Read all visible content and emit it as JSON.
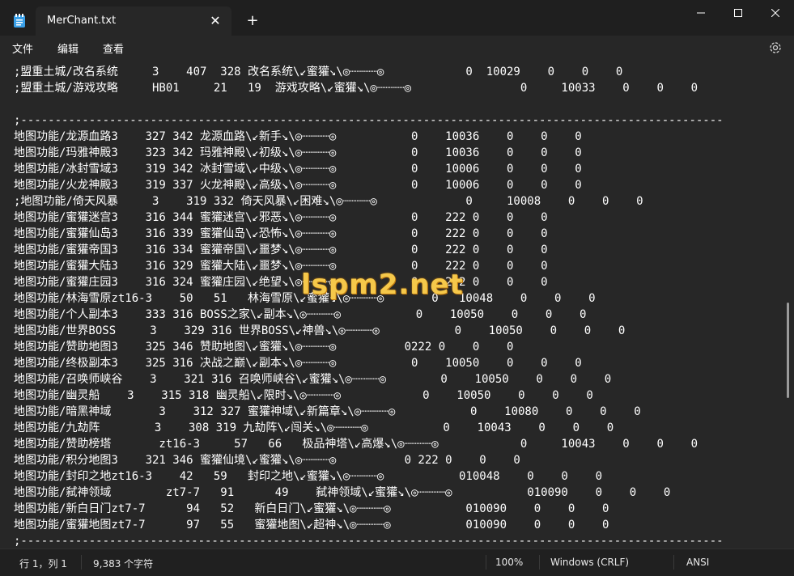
{
  "window": {
    "tab_title": "MerChant.txt",
    "tab_close": "✕",
    "new_tab": "+",
    "minimize": "—",
    "maximize": "☐",
    "close": "✕"
  },
  "menu": {
    "file": "文件",
    "edit": "编辑",
    "view": "查看"
  },
  "editor": {
    "lines": [
      ";盟重土城/改名系统     3    407  328 改名系统\\↙蜜獾↘\\◎┈┈┈┈◎            0  10029    0    0    0",
      ";盟重土城/游戏攻略     HB01     21   19  游戏攻略\\↙蜜獾↘\\◎┈┈┈┈◎                0     10033    0    0    0",
      "",
      ";-------------------------------------------------------------------------------------------------------",
      "地图功能/龙源血路3    327 342 龙源血路\\↙新手↘\\◎┈┈┈┈◎           0    10036    0    0    0",
      "地图功能/玛雅神殿3    323 342 玛雅神殿\\↙初级↘\\◎┈┈┈┈◎           0    10036    0    0    0",
      "地图功能/冰封雪域3    319 342 冰封雪域\\↙中级↘\\◎┈┈┈┈◎           0    10006    0    0    0",
      "地图功能/火龙神殿3    319 337 火龙神殿\\↙高级↘\\◎┈┈┈┈◎           0    10006    0    0    0",
      ";地图功能/倚天风暴     3    319 332 倚天风暴\\↙困难↘\\◎┈┈┈┈◎             0     10008    0    0    0",
      "地图功能/蜜獾迷宫3    316 344 蜜獾迷宫\\↙邪恶↘\\◎┈┈┈┈◎           0    222 0    0    0",
      "地图功能/蜜獾仙岛3    316 339 蜜獾仙岛\\↙恐怖↘\\◎┈┈┈┈◎           0    222 0    0    0",
      "地图功能/蜜獾帝国3    316 334 蜜獾帝国\\↙噩梦↘\\◎┈┈┈┈◎           0    222 0    0    0",
      "地图功能/蜜獾大陆3    316 329 蜜獾大陆\\↙噩梦↘\\◎┈┈┈┈◎           0    222 0    0    0",
      "地图功能/蜜獾庄园3    316 324 蜜獾庄园\\↙绝望↘\\◎┈┈┈┈◎           0    222 0    0    0",
      "地图功能/林海雪原zt16-3    50   51   林海雪原\\↙蜜獾↘\\◎┈┈┈┈◎       0   10048    0    0    0",
      "地图功能/个人副本3    333 316 BOSS之家\\↙副本↘\\◎┈┈┈┈◎           0    10050    0    0    0",
      "地图功能/世界BOSS     3    329 316 世界BOSS\\↙神兽↘\\◎┈┈┈┈◎           0    10050    0    0    0",
      "地图功能/赞助地图3    325 346 赞助地图\\↙蜜獾↘\\◎┈┈┈┈◎          0222 0    0    0",
      "地图功能/终极副本3    325 316 决战之巅\\↙副本↘\\◎┈┈┈┈◎           0    10050    0    0    0",
      "地图功能/召唤师峡谷    3    321 316 召唤师峡谷\\↙蜜獾↘\\◎┈┈┈┈◎        0    10050    0    0    0",
      "地图功能/幽灵船    3    315 318 幽灵船\\↙限时↘\\◎┈┈┈┈◎            0    10050    0    0    0",
      "地图功能/暗黑神域       3    312 327 蜜獾神域\\↙新篇章↘\\◎┈┈┈┈◎           0    10080    0    0    0",
      "地图功能/九劫阵        3    308 319 九劫阵\\↙闯关↘\\◎┈┈┈┈◎           0    10043    0    0    0",
      "地图功能/赞助榜塔       zt16-3     57   66   极品神塔\\↙高爆↘\\◎┈┈┈┈◎            0     10043    0    0    0",
      "地图功能/积分地图3    321 346 蜜獾仙境\\↙蜜獾↘\\◎┈┈┈┈◎          0 222 0    0    0",
      "地图功能/封印之地zt16-3    42   59   封印之地\\↙蜜獾↘\\◎┈┈┈┈◎           010048    0    0    0",
      "地图功能/弑神领域        zt7-7   91      49    弑神领域\\↙蜜獾↘\\◎┈┈┈┈◎           010090    0    0    0",
      "地图功能/新白日门zt7-7      94   52   新白日门\\↙蜜獾↘\\◎┈┈┈┈◎           010090    0    0    0",
      "地图功能/蜜獾地图zt7-7      97   55   蜜獾地图\\↙超神↘\\◎┈┈┈┈◎           010090    0    0    0",
      ";-------------------------------------------------------------------------------------------------------"
    ]
  },
  "watermark": "lspm2.net",
  "status": {
    "position": "行 1，列 1",
    "char_count": "9,383 个字符",
    "zoom": "100%",
    "line_ending": "Windows (CRLF)",
    "encoding": "ANSI"
  }
}
